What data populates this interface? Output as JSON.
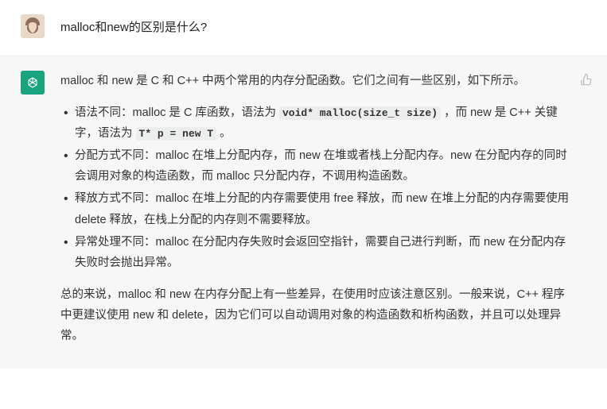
{
  "user": {
    "question": "malloc和new的区别是什么?"
  },
  "assistant": {
    "intro": "malloc 和 new 是 C 和 C++ 中两个常用的内存分配函数。它们之间有一些区别，如下所示。",
    "points": [
      {
        "prefix": "语法不同：malloc 是 C 库函数，语法为 ",
        "code1": "void* malloc(size_t size)",
        "mid": " ，而 new 是 C++ 关键字，语法为 ",
        "code2": "T* p = new T",
        "suffix": " 。"
      },
      {
        "text": "分配方式不同：malloc 在堆上分配内存，而 new 在堆或者栈上分配内存。new 在分配内存的同时会调用对象的构造函数，而 malloc 只分配内存，不调用构造函数。"
      },
      {
        "text": "释放方式不同：malloc 在堆上分配的内存需要使用 free 释放，而 new 在堆上分配的内存需要使用 delete 释放，在栈上分配的内存则不需要释放。"
      },
      {
        "text": "异常处理不同：malloc 在分配内存失败时会返回空指针，需要自己进行判断，而 new 在分配内存失败时会抛出异常。"
      }
    ],
    "summary": "总的来说，malloc 和 new 在内存分配上有一些差异，在使用时应该注意区别。一般来说，C++ 程序中更建议使用 new 和 delete，因为它们可以自动调用对象的构造函数和析构函数，并且可以处理异常。"
  }
}
